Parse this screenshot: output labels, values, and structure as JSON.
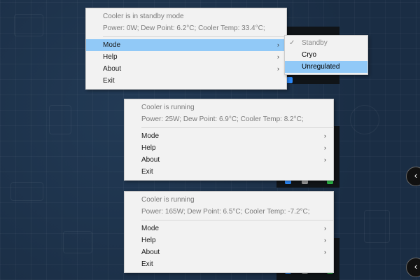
{
  "menus": [
    {
      "info_title": "Cooler is in standby mode",
      "info_stats": "Power: 0W; Dew Point: 6.2°C; Cooler Temp: 33.4°C;",
      "items": [
        {
          "label": "Mode",
          "has_submenu": true
        },
        {
          "label": "Help",
          "has_submenu": true
        },
        {
          "label": "About",
          "has_submenu": true
        },
        {
          "label": "Exit",
          "has_submenu": false
        }
      ],
      "highlighted": "Mode",
      "submenu": {
        "items": [
          {
            "label": "Standby",
            "checked": true,
            "disabled": true
          },
          {
            "label": "Cryo",
            "checked": false,
            "disabled": false
          },
          {
            "label": "Unregulated",
            "checked": false,
            "disabled": false
          }
        ],
        "highlighted": "Unregulated"
      }
    },
    {
      "info_title": "Cooler is running",
      "info_stats": "Power: 25W; Dew Point: 6.9°C; Cooler Temp: 8.2°C;",
      "items": [
        {
          "label": "Mode",
          "has_submenu": true
        },
        {
          "label": "Help",
          "has_submenu": true
        },
        {
          "label": "About",
          "has_submenu": true
        },
        {
          "label": "Exit",
          "has_submenu": false
        }
      ]
    },
    {
      "info_title": "Cooler is running",
      "info_stats": "Power: 165W; Dew Point: 6.5°C; Cooler Temp: -7.2°C;",
      "items": [
        {
          "label": "Mode",
          "has_submenu": true
        },
        {
          "label": "Help",
          "has_submenu": true
        },
        {
          "label": "About",
          "has_submenu": true
        },
        {
          "label": "Exit",
          "has_submenu": false
        }
      ]
    }
  ],
  "submenu_arrow": "›",
  "checkmark": "✓",
  "edge_button_glyph": "‹",
  "colors": {
    "highlight": "#91c9f7",
    "menu_bg": "#f2f2f2",
    "wallpaper": "#1c3149"
  }
}
